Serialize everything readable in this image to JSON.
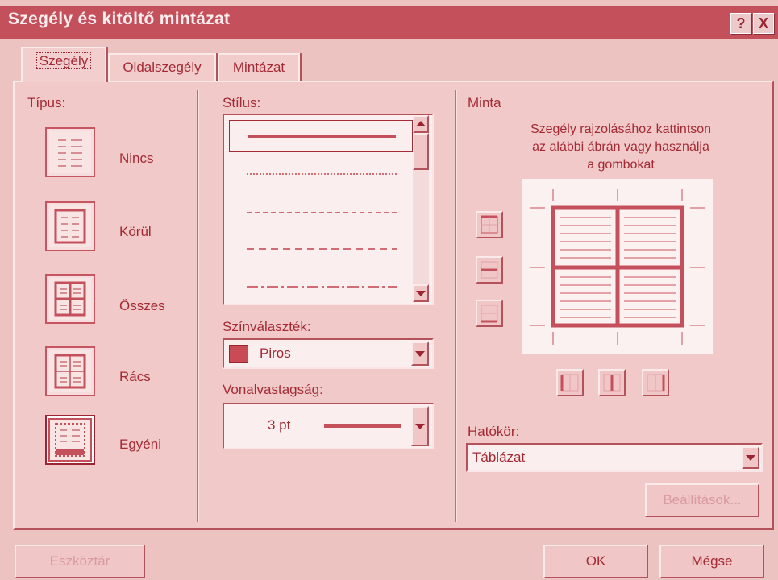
{
  "title": "Szegély és kitöltő mintázat",
  "title_buttons": {
    "help": "?",
    "close": "X"
  },
  "tabs": [
    {
      "label": "Szegély"
    },
    {
      "label": "Oldalszegély"
    },
    {
      "label": "Mintázat"
    }
  ],
  "tipus": {
    "label": "Típus:",
    "options": [
      {
        "label": "Nincs"
      },
      {
        "label": "Körül"
      },
      {
        "label": "Összes"
      },
      {
        "label": "Rács"
      },
      {
        "label": "Egyéni"
      }
    ]
  },
  "stilus": {
    "label": "Stílus:",
    "styles": [
      "solid",
      "dotted",
      "dashed-small",
      "dashed",
      "dash-dot"
    ]
  },
  "szinvalasztek": {
    "label": "Színválaszték:",
    "value": "Piros",
    "swatch": "#c94b55"
  },
  "vonalvastagsag": {
    "label": "Vonalvastagság:",
    "value": "3 pt"
  },
  "minta": {
    "label": "Minta",
    "instruction_1": "Szegély rajzolásához kattintson",
    "instruction_2": "az alábbi ábrán vagy használja",
    "instruction_3": "a gombokat"
  },
  "hatokor": {
    "label": "Hatókör:",
    "value": "Táblázat"
  },
  "buttons": {
    "beallitasok": "Beállítások...",
    "eszkoztar": "Eszköztár",
    "ok": "OK",
    "megse": "Mégse"
  },
  "colors": {
    "accent": "#c4505c",
    "text": "#a42a35",
    "face": "#edc3c2"
  }
}
